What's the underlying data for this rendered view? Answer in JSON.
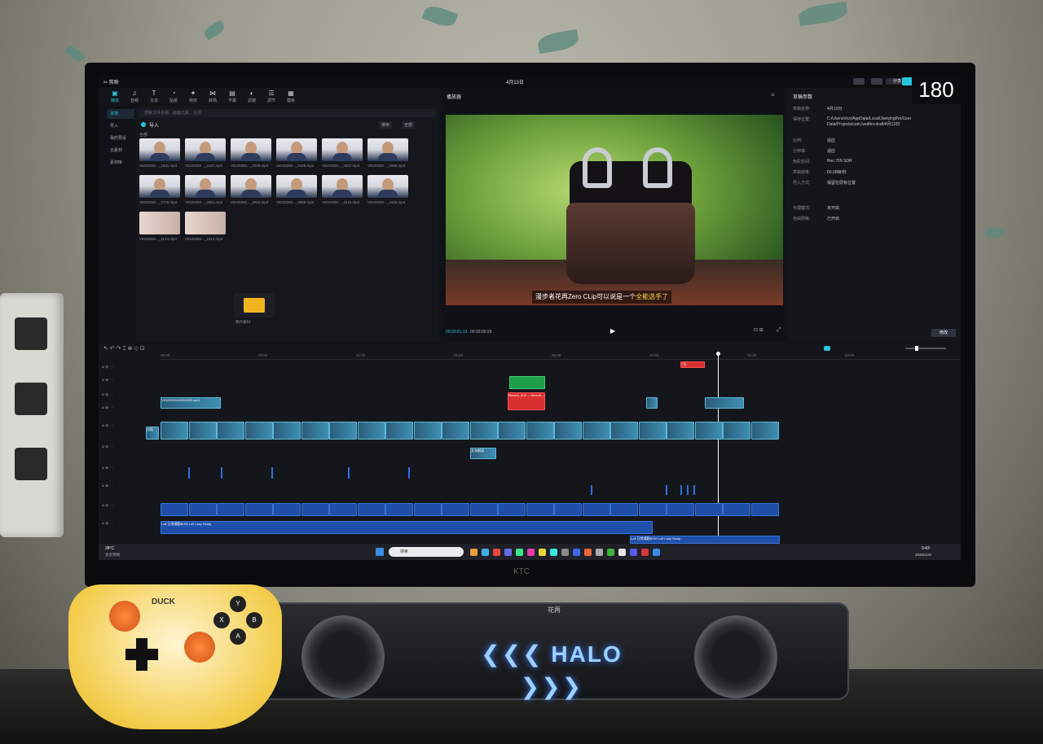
{
  "monitor": {
    "refresh_badge": "180",
    "logo": "KTC"
  },
  "app": {
    "title_date": "4月13日",
    "toolbar": [
      {
        "label": "媒体",
        "icon": "media-icon",
        "active": true
      },
      {
        "label": "音频",
        "icon": "audio-icon"
      },
      {
        "label": "文本",
        "icon": "text-icon"
      },
      {
        "label": "贴纸",
        "icon": "sticker-icon"
      },
      {
        "label": "特效",
        "icon": "effect-icon"
      },
      {
        "label": "转场",
        "icon": "transition-icon"
      },
      {
        "label": "字幕",
        "icon": "caption-icon"
      },
      {
        "label": "滤镜",
        "icon": "filter-icon"
      },
      {
        "label": "调节",
        "icon": "adjust-icon"
      },
      {
        "label": "模板",
        "icon": "template-icon"
      }
    ],
    "left_nav": [
      "本地",
      "导入",
      "我的预设",
      "云素材",
      "素材库"
    ],
    "media": {
      "import_label": "导入",
      "section_label": "全部",
      "search_placeholder": "搜索文件名称、画面元素、台词",
      "sort_label": "排序",
      "all_label": "全部",
      "files": [
        "VID20250..._1921.mp4",
        "VID20250..._2127.mp4",
        "VID20250..._2339.mp4",
        "VID20250..._2426.mp4",
        "VID20250..._2537.mp4",
        "VID20250..._2650.mp4",
        "VID20250..._2719.mp4",
        "VID20250..._2851.mp4",
        "VID20250..._3020.mp4",
        "VID20250..._3956.mp4",
        "VID20250..._4218.mp4",
        "VID20250..._4425.mp4",
        "VID20250..._1144.mp4",
        "VID20250..._1014.mp4"
      ],
      "folder_label": "我的素材"
    },
    "player": {
      "title": "播放器",
      "subtitle_pre": "漫步者花再Zero CLip可以说是一个",
      "subtitle_hl": "全能选手了",
      "current_time": "00:02:51:12",
      "total_time": "00:03:09:29"
    },
    "properties": {
      "title": "草稿参数",
      "rows": [
        {
          "k": "草稿名称:",
          "v": "4月13日"
        },
        {
          "k": "保存位置:",
          "v": "C:/Users/vico/AppData/Local/JianyingPro/User Data/Projects/com.lveditor.draft/4月13日"
        },
        {
          "k": "比例:",
          "v": "适应"
        },
        {
          "k": "分辨率:",
          "v": "适应"
        },
        {
          "k": "色彩空间:",
          "v": "Rec.709 SDR"
        },
        {
          "k": "草稿帧率:",
          "v": "60.00帧/秒"
        },
        {
          "k": "导入方式:",
          "v": "保留在原有位置"
        },
        {
          "k": "代理模式:",
          "v": "未开启"
        },
        {
          "k": "自由层级:",
          "v": "已开启"
        }
      ],
      "edit_button": "修改"
    },
    "timeline": {
      "ruler": [
        "00:00",
        "00:50",
        "01:00",
        "01:50",
        "02:00",
        "02:50",
        "03:00",
        "03:50"
      ],
      "clips": {
        "main_first": "VID20250413001925.mp4",
        "red_clip": "Record_202 ... Record_ Audio Not Found",
        "audio_track": "Lofi 日常通勤BGM  Lofi Lazy Study",
        "audio_track2": "Lofi 日常通勤BGM  Lofi Lazy Study",
        "cover_label": "封面",
        "caption_clip": "文本朗读",
        "red_top": "7月"
      }
    },
    "taskbar": {
      "weather_temp": "28°C",
      "weather_desc": "多云转晴",
      "search_placeholder": "搜索",
      "time": "0:43",
      "date": "2025/4/20"
    }
  },
  "speaker": {
    "brand": "花再",
    "halo": "HALO"
  },
  "gamepad": {
    "label": "DUCK",
    "buttons": [
      "X",
      "Y",
      "A",
      "B"
    ]
  }
}
